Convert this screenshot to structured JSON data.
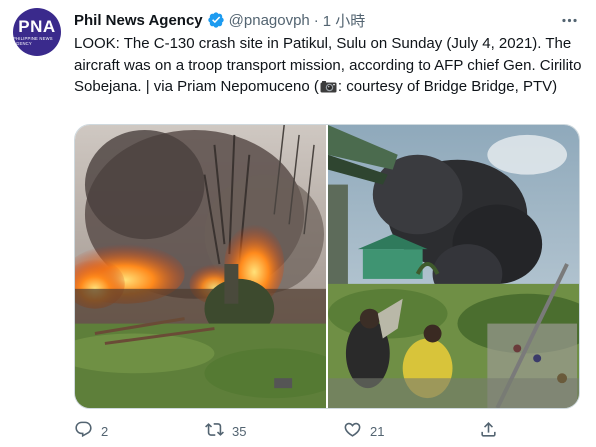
{
  "account": {
    "name": "Phil News Agency",
    "handle": "@pnagovph",
    "separator": "·",
    "time": "1 小時",
    "avatar_text": "PNA",
    "avatar_subtext": "PHILIPPINE NEWS AGENCY",
    "verified": true
  },
  "tweet": {
    "text_before_icon": "LOOK: The C-130 crash site in Patikul, Sulu on Sunday (July 4, 2021). The aircraft was on a troop transport mission, according to AFP chief Gen. Cirilito Sobejana. | via Priam Nepomuceno (",
    "icon": "camera-emoji",
    "text_after_icon": ": courtesy of Bridge Bridge, PTV)"
  },
  "media": {
    "left_photo": "crash-site-fire-photo",
    "right_photo": "smoke-over-village-photo"
  },
  "actions": {
    "reply_count": "2",
    "retweet_count": "35",
    "like_count": "21",
    "share_count": ""
  },
  "colors": {
    "accent": "#1d9bf0",
    "secondary_text": "#536471",
    "avatar_bg": "#3a2a8c"
  }
}
